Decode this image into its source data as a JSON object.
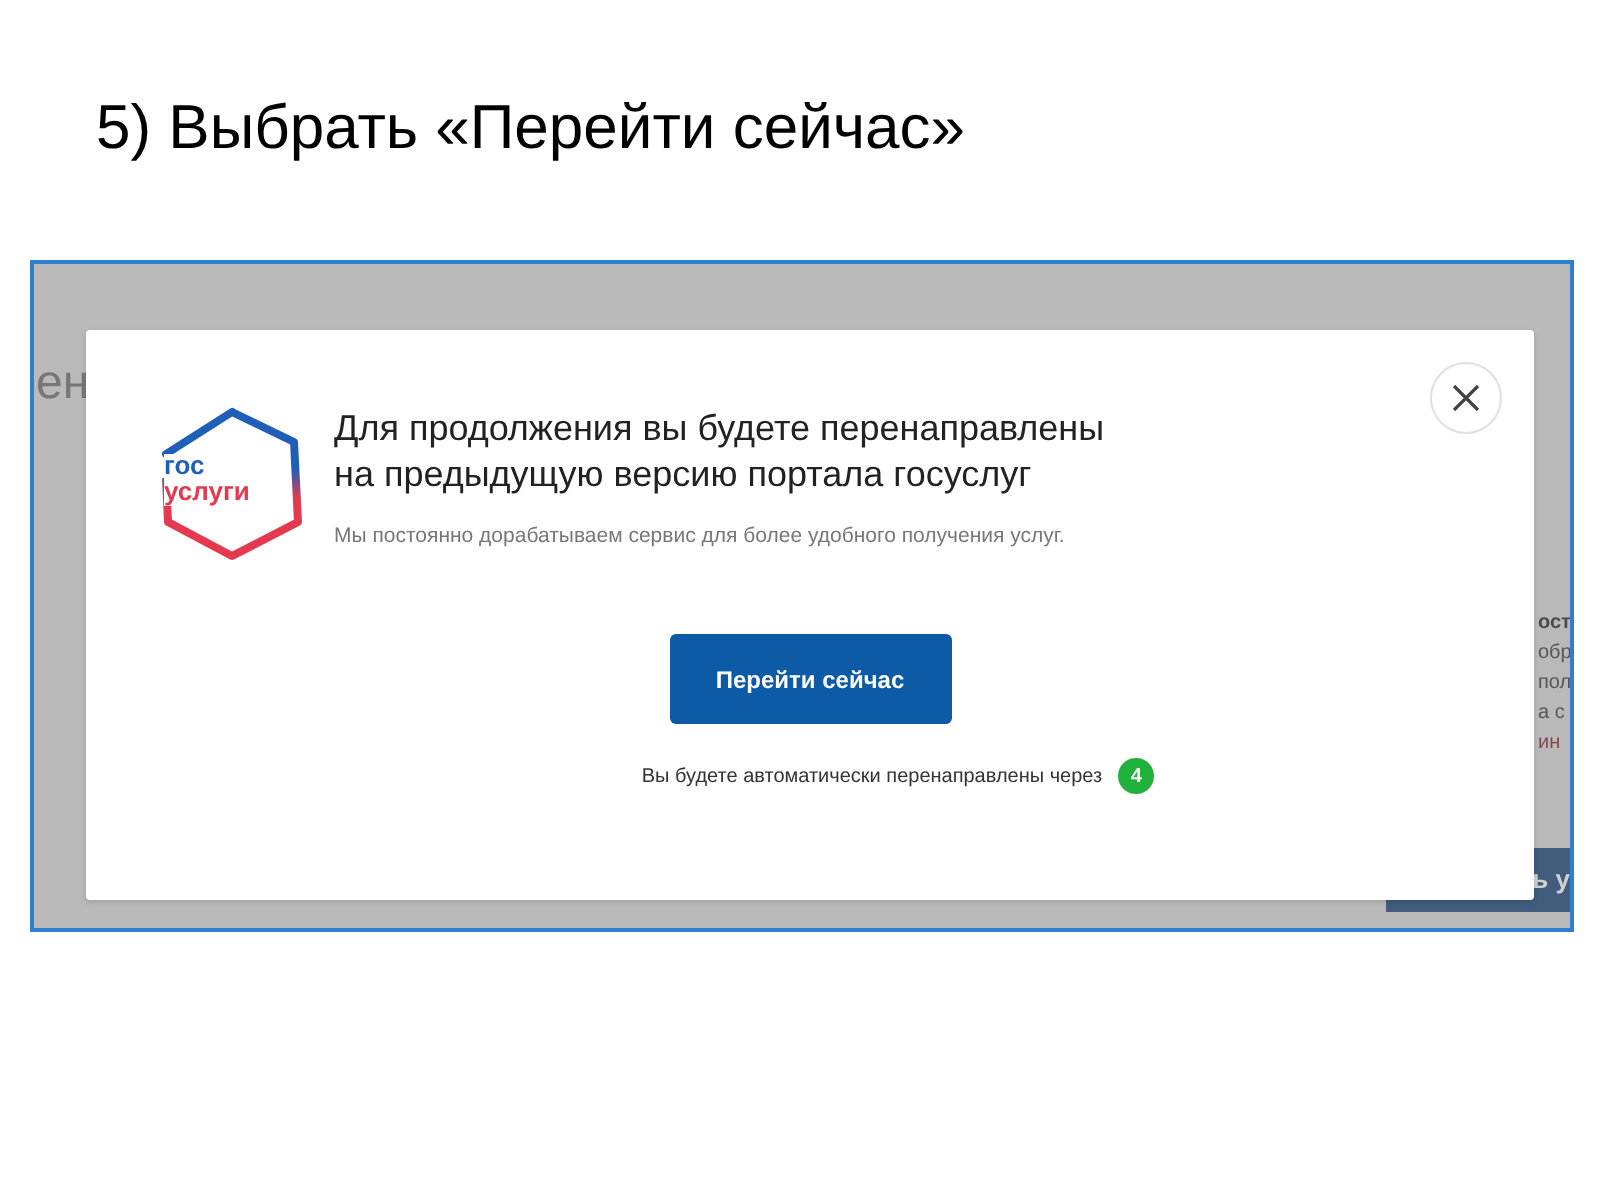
{
  "slide_title": "5) Выбрать «Перейти сейчас»",
  "background_page": {
    "heading_fragment": "ен",
    "side_text_fragments": [
      {
        "text": "ост",
        "kind": "bold"
      },
      {
        "text": "обр",
        "kind": "plain"
      },
      {
        "text": "пол",
        "kind": "plain"
      },
      {
        "text": "а с",
        "kind": "plain"
      },
      {
        "text": "ин",
        "kind": "accent"
      }
    ],
    "button_fragment": "ь у"
  },
  "modal": {
    "logo": {
      "line_1": "гос",
      "line_2": "услуги"
    },
    "title_lines": [
      "Для продолжения вы будете перенаправлены",
      "на предыдущую версию портала госуслуг"
    ],
    "subtitle": "Мы постоянно дорабатываем сервис для более удобного получения услуг.",
    "primary_button": "Перейти сейчас",
    "countdown_text": "Вы будете автоматически перенаправлены через",
    "countdown_value": "4"
  }
}
